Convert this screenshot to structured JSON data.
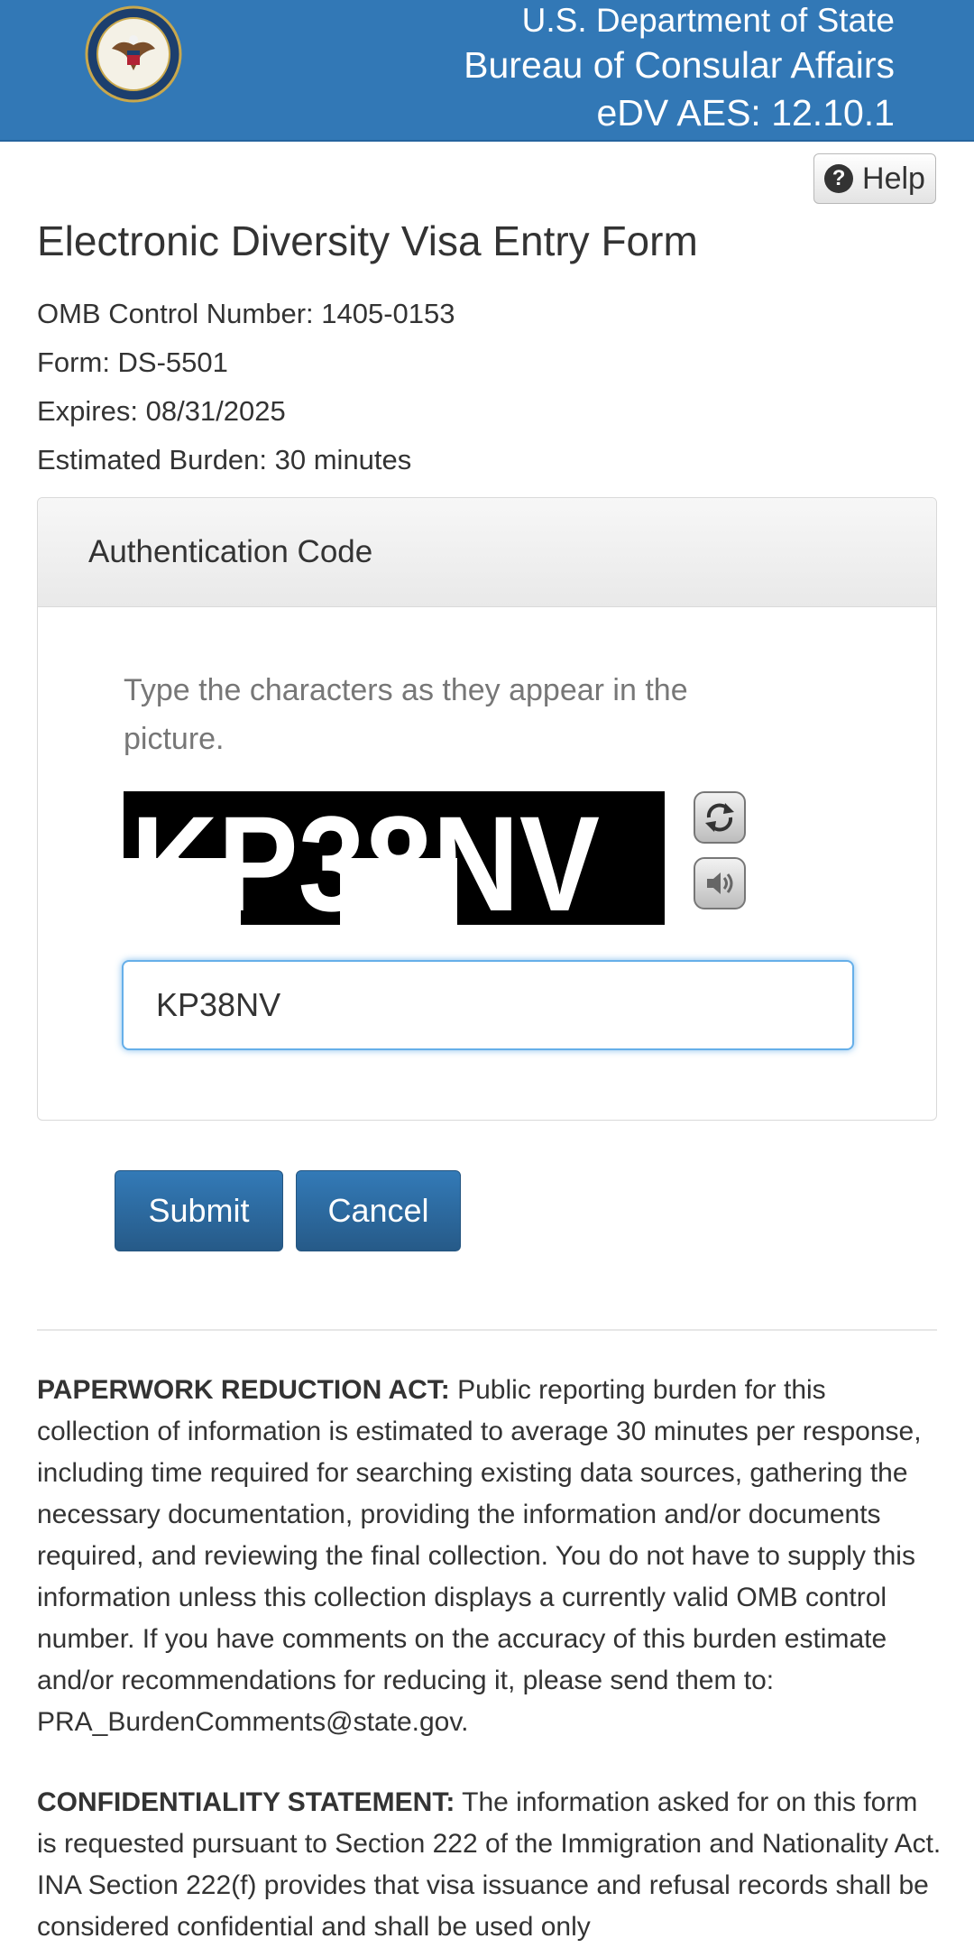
{
  "header": {
    "line1": "U.S. Department of State",
    "line2": "Bureau of Consular Affairs",
    "line3": "eDV AES: 12.10.1",
    "background": "#3278b6"
  },
  "help": {
    "label": "Help",
    "icon": "question-circle-icon"
  },
  "title": "Electronic Diversity Visa Entry Form",
  "meta": {
    "omb": "OMB Control Number: 1405-0153",
    "form": "Form: DS-5501",
    "expires": "Expires: 08/31/2025",
    "burden": "Estimated Burden: 30 minutes"
  },
  "auth": {
    "heading": "Authentication Code",
    "instruction": "Type the characters as they appear in the picture.",
    "captcha_text": "KP38NV",
    "input_value": "KP38NV",
    "refresh_icon": "refresh-icon",
    "audio_icon": "speaker-icon"
  },
  "buttons": {
    "submit": "Submit",
    "cancel": "Cancel"
  },
  "paperwork": {
    "heading": "PAPERWORK REDUCTION ACT:",
    "body": " Public reporting burden for this collection of information is estimated to average 30 minutes per response, including time required for searching existing data sources, gathering the necessary documentation, providing the information and/or documents required, and reviewing the final collection. You do not have to supply this information unless this collection displays a currently valid OMB control number. If you have comments on the accuracy of this burden estimate and/or recommendations for reducing it, please send them to: PRA_BurdenComments@state.gov."
  },
  "confidentiality": {
    "heading": "CONFIDENTIALITY STATEMENT:",
    "body": " The information asked for on this form is requested pursuant to Section 222 of the Immigration and Nationality Act. INA Section 222(f) provides that visa issuance and refusal records shall be considered confidential and shall be used only"
  }
}
